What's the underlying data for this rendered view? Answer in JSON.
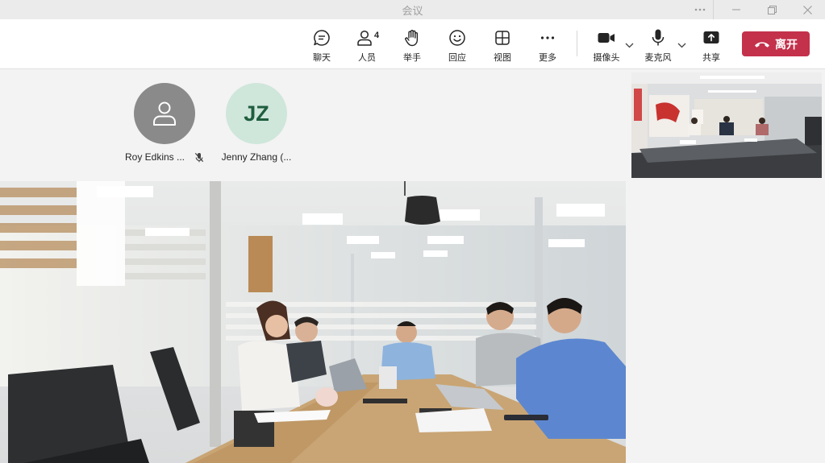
{
  "window": {
    "title": "会议"
  },
  "toolbar": {
    "chat_label": "聊天",
    "people_label": "人员",
    "people_count": "4",
    "raise_hand_label": "举手",
    "react_label": "回应",
    "view_label": "视图",
    "more_label": "更多",
    "camera_label": "摄像头",
    "mic_label": "麦克风",
    "share_label": "共享",
    "leave_label": "离开",
    "leave_color": "#c4314b"
  },
  "participants": [
    {
      "name": "Roy Edkins ...",
      "avatar": "person-icon",
      "muted": true
    },
    {
      "name": "Jenny Zhang (...",
      "initials": "JZ",
      "avatar_color": "#cfe6db"
    }
  ]
}
